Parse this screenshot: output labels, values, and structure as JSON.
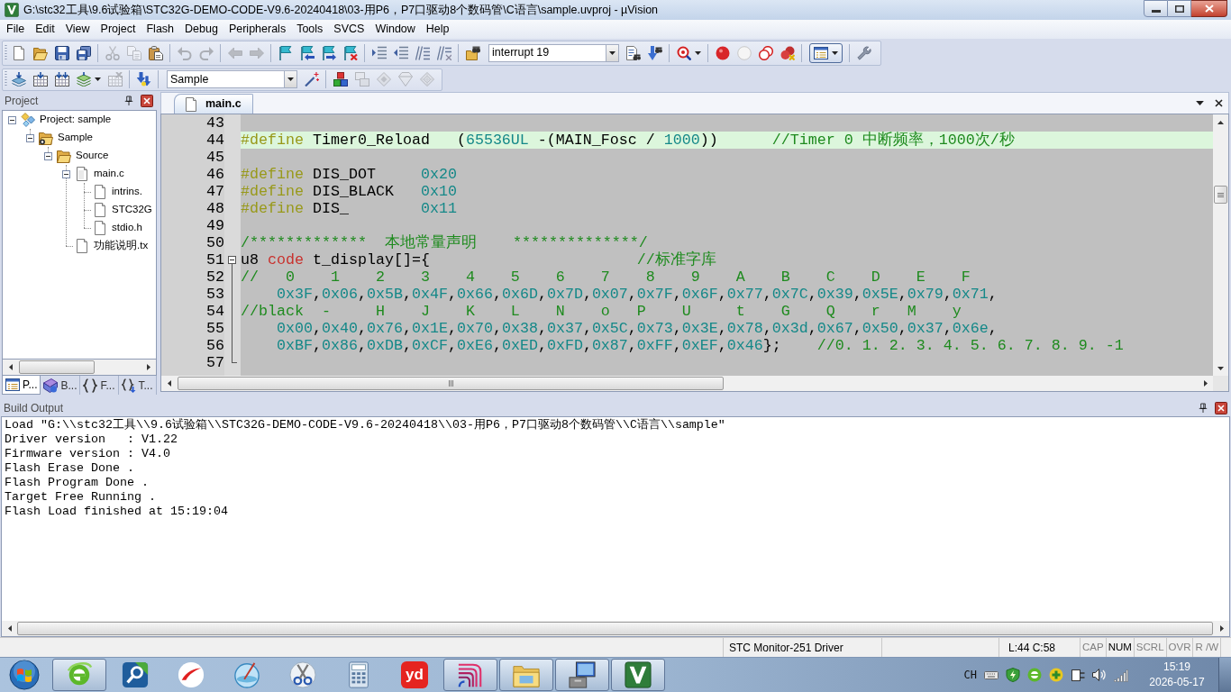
{
  "window": {
    "title": "G:\\stc32工具\\9.6试验箱\\STC32G-DEMO-CODE-V9.6-20240418\\03-用P6，P7口驱动8个数码管\\C语言\\sample.uvproj - µVision"
  },
  "menu": [
    "File",
    "Edit",
    "View",
    "Project",
    "Flash",
    "Debug",
    "Peripherals",
    "Tools",
    "SVCS",
    "Window",
    "Help"
  ],
  "toolbar_1": [
    [
      {
        "kind": "new",
        "disabled": false
      },
      {
        "kind": "open",
        "disabled": false
      },
      {
        "kind": "save",
        "disabled": false
      },
      {
        "kind": "save_all",
        "disabled": false
      }
    ],
    [
      {
        "kind": "cut",
        "disabled": true
      },
      {
        "kind": "copy",
        "disabled": true
      },
      {
        "kind": "paste",
        "disabled": false
      }
    ],
    [
      {
        "kind": "undo",
        "disabled": true
      },
      {
        "kind": "redo",
        "disabled": true
      }
    ],
    [
      {
        "kind": "back",
        "disabled": true
      },
      {
        "kind": "forward",
        "disabled": true
      }
    ],
    [
      {
        "kind": "bookmark",
        "disabled": false
      },
      {
        "kind": "bookmark_prev",
        "disabled": false
      },
      {
        "kind": "bookmark_next",
        "disabled": false
      },
      {
        "kind": "bookmark_clear",
        "disabled": false
      }
    ],
    [
      {
        "kind": "indent",
        "disabled": false
      },
      {
        "kind": "outdent",
        "disabled": false
      },
      {
        "kind": "comment",
        "disabled": false
      },
      {
        "kind": "uncomment",
        "disabled": false
      }
    ],
    [
      {
        "kind": "find_in_files",
        "disabled": false
      },
      {
        "kind": "combo",
        "value": "interrupt 19",
        "disabled": false
      },
      {
        "kind": "find",
        "disabled": false
      },
      {
        "kind": "incremental_find",
        "disabled": false
      }
    ],
    [
      {
        "kind": "debug",
        "disabled": false
      }
    ],
    [
      {
        "kind": "breakpoint",
        "disabled": false
      },
      {
        "kind": "breakpoint_enable",
        "disabled": false
      },
      {
        "kind": "breakpoint_disable_all",
        "disabled": false
      },
      {
        "kind": "breakpoint_kill_all",
        "disabled": false
      }
    ],
    [
      {
        "kind": "window_layout",
        "disabled": false
      }
    ],
    [
      {
        "kind": "configure",
        "disabled": false
      }
    ]
  ],
  "toolbar_2": [
    [
      {
        "kind": "translate",
        "disabled": false
      },
      {
        "kind": "build",
        "disabled": false
      },
      {
        "kind": "rebuild",
        "disabled": false
      },
      {
        "kind": "batch_build",
        "disabled": false
      },
      {
        "kind": "stop_build",
        "disabled": true
      }
    ],
    [
      {
        "kind": "download",
        "disabled": false
      }
    ],
    [
      {
        "kind": "combo",
        "value": "Sample",
        "disabled": false
      },
      {
        "kind": "target_options",
        "disabled": false
      }
    ],
    [
      {
        "kind": "components",
        "disabled": false
      },
      {
        "kind": "packs",
        "disabled": true
      },
      {
        "kind": "diamond",
        "disabled": true
      },
      {
        "kind": "gem",
        "disabled": true
      },
      {
        "kind": "gems",
        "disabled": true
      }
    ]
  ],
  "project_panel": {
    "title": "Project",
    "tree": [
      {
        "label": "Project: sample",
        "kind": "project",
        "expanded": true,
        "children": [
          {
            "label": "Sample",
            "kind": "group",
            "expanded": true,
            "children": [
              {
                "label": "Source",
                "kind": "folder",
                "expanded": true,
                "children": [
                  {
                    "label": "main.c",
                    "kind": "c_file",
                    "expanded": true,
                    "children": [
                      {
                        "label": "intrins.",
                        "kind": "header_file"
                      },
                      {
                        "label": "STC32G",
                        "kind": "header_file"
                      },
                      {
                        "label": "stdio.h",
                        "kind": "header_file"
                      }
                    ]
                  },
                  {
                    "label": "功能说明.tx",
                    "kind": "text_file"
                  }
                ]
              }
            ]
          }
        ]
      }
    ],
    "tabs": [
      {
        "label": "P...",
        "kind": "project",
        "selected": true
      },
      {
        "label": "B...",
        "kind": "books",
        "selected": false
      },
      {
        "label": "F...",
        "kind": "functions",
        "selected": false
      },
      {
        "label": "T...",
        "kind": "templates",
        "selected": false
      }
    ]
  },
  "editor": {
    "tabs": [
      {
        "label": "main.c",
        "selected": true
      }
    ],
    "lines": [
      {
        "number": "43",
        "current": false,
        "collapsible": false,
        "in_fold": false
      },
      {
        "number": "44",
        "current": true,
        "collapsible": false,
        "in_fold": false,
        "tokens": [
          {
            "kind": "preprocessor",
            "text": "#define"
          },
          {
            "kind": "plain",
            "text": " Timer0_Reload   ("
          },
          {
            "kind": "number",
            "text": "65536UL"
          },
          {
            "kind": "plain",
            "text": " -(MAIN_Fosc / "
          },
          {
            "kind": "number",
            "text": "1000"
          },
          {
            "kind": "plain",
            "text": "))      "
          },
          {
            "kind": "comment",
            "text": "//Timer 0 中断频率，1000次/秒"
          }
        ]
      },
      {
        "number": "45",
        "current": false,
        "collapsible": false,
        "in_fold": false
      },
      {
        "number": "46",
        "current": false,
        "collapsible": false,
        "in_fold": false,
        "tokens": [
          {
            "kind": "preprocessor",
            "text": "#define"
          },
          {
            "kind": "plain",
            "text": " DIS_DOT     "
          },
          {
            "kind": "number",
            "text": "0x20"
          }
        ]
      },
      {
        "number": "47",
        "current": false,
        "collapsible": false,
        "in_fold": false,
        "tokens": [
          {
            "kind": "preprocessor",
            "text": "#define"
          },
          {
            "kind": "plain",
            "text": " DIS_BLACK   "
          },
          {
            "kind": "number",
            "text": "0x10"
          }
        ]
      },
      {
        "number": "48",
        "current": false,
        "collapsible": false,
        "in_fold": false,
        "tokens": [
          {
            "kind": "preprocessor",
            "text": "#define"
          },
          {
            "kind": "plain",
            "text": " DIS_        "
          },
          {
            "kind": "number",
            "text": "0x11"
          }
        ]
      },
      {
        "number": "49",
        "current": false,
        "collapsible": false,
        "in_fold": false
      },
      {
        "number": "50",
        "current": false,
        "collapsible": false,
        "in_fold": false,
        "tokens": [
          {
            "kind": "comment",
            "text": "/*************  本地常量声明    **************/"
          }
        ]
      },
      {
        "number": "51",
        "current": false,
        "collapsible": true,
        "in_fold": false,
        "tokens": [
          {
            "kind": "plain",
            "text": "u8 "
          },
          {
            "kind": "keyword",
            "text": "code"
          },
          {
            "kind": "plain",
            "text": " t_display[]={                       "
          },
          {
            "kind": "comment",
            "text": "//标准字库"
          }
        ]
      },
      {
        "number": "52",
        "current": false,
        "collapsible": false,
        "in_fold": true,
        "tokens": [
          {
            "kind": "comment",
            "text": "//   0    1    2    3    4    5    6    7    8    9    A    B    C    D    E    F"
          }
        ]
      },
      {
        "number": "53",
        "current": false,
        "collapsible": false,
        "in_fold": true,
        "tokens": [
          {
            "kind": "number",
            "text": "    0x3F"
          },
          {
            "kind": "plain",
            "text": ","
          },
          {
            "kind": "number",
            "text": "0x06"
          },
          {
            "kind": "plain",
            "text": ","
          },
          {
            "kind": "number",
            "text": "0x5B"
          },
          {
            "kind": "plain",
            "text": ","
          },
          {
            "kind": "number",
            "text": "0x4F"
          },
          {
            "kind": "plain",
            "text": ","
          },
          {
            "kind": "number",
            "text": "0x66"
          },
          {
            "kind": "plain",
            "text": ","
          },
          {
            "kind": "number",
            "text": "0x6D"
          },
          {
            "kind": "plain",
            "text": ","
          },
          {
            "kind": "number",
            "text": "0x7D"
          },
          {
            "kind": "plain",
            "text": ","
          },
          {
            "kind": "number",
            "text": "0x07"
          },
          {
            "kind": "plain",
            "text": ","
          },
          {
            "kind": "number",
            "text": "0x7F"
          },
          {
            "kind": "plain",
            "text": ","
          },
          {
            "kind": "number",
            "text": "0x6F"
          },
          {
            "kind": "plain",
            "text": ","
          },
          {
            "kind": "number",
            "text": "0x77"
          },
          {
            "kind": "plain",
            "text": ","
          },
          {
            "kind": "number",
            "text": "0x7C"
          },
          {
            "kind": "plain",
            "text": ","
          },
          {
            "kind": "number",
            "text": "0x39"
          },
          {
            "kind": "plain",
            "text": ","
          },
          {
            "kind": "number",
            "text": "0x5E"
          },
          {
            "kind": "plain",
            "text": ","
          },
          {
            "kind": "number",
            "text": "0x79"
          },
          {
            "kind": "plain",
            "text": ","
          },
          {
            "kind": "number",
            "text": "0x71"
          },
          {
            "kind": "plain",
            "text": ","
          }
        ]
      },
      {
        "number": "54",
        "current": false,
        "collapsible": false,
        "in_fold": true,
        "tokens": [
          {
            "kind": "comment",
            "text": "//black  -     H    J    K    L    N    o   P    U     t    G    Q    r   M    y"
          }
        ]
      },
      {
        "number": "55",
        "current": false,
        "collapsible": false,
        "in_fold": true,
        "tokens": [
          {
            "kind": "number",
            "text": "    0x00"
          },
          {
            "kind": "plain",
            "text": ","
          },
          {
            "kind": "number",
            "text": "0x40"
          },
          {
            "kind": "plain",
            "text": ","
          },
          {
            "kind": "number",
            "text": "0x76"
          },
          {
            "kind": "plain",
            "text": ","
          },
          {
            "kind": "number",
            "text": "0x1E"
          },
          {
            "kind": "plain",
            "text": ","
          },
          {
            "kind": "number",
            "text": "0x70"
          },
          {
            "kind": "plain",
            "text": ","
          },
          {
            "kind": "number",
            "text": "0x38"
          },
          {
            "kind": "plain",
            "text": ","
          },
          {
            "kind": "number",
            "text": "0x37"
          },
          {
            "kind": "plain",
            "text": ","
          },
          {
            "kind": "number",
            "text": "0x5C"
          },
          {
            "kind": "plain",
            "text": ","
          },
          {
            "kind": "number",
            "text": "0x73"
          },
          {
            "kind": "plain",
            "text": ","
          },
          {
            "kind": "number",
            "text": "0x3E"
          },
          {
            "kind": "plain",
            "text": ","
          },
          {
            "kind": "number",
            "text": "0x78"
          },
          {
            "kind": "plain",
            "text": ","
          },
          {
            "kind": "number",
            "text": "0x3d"
          },
          {
            "kind": "plain",
            "text": ","
          },
          {
            "kind": "number",
            "text": "0x67"
          },
          {
            "kind": "plain",
            "text": ","
          },
          {
            "kind": "number",
            "text": "0x50"
          },
          {
            "kind": "plain",
            "text": ","
          },
          {
            "kind": "number",
            "text": "0x37"
          },
          {
            "kind": "plain",
            "text": ","
          },
          {
            "kind": "number",
            "text": "0x6e"
          },
          {
            "kind": "plain",
            "text": ","
          }
        ]
      },
      {
        "number": "56",
        "current": false,
        "collapsible": false,
        "in_fold": true,
        "tokens": [
          {
            "kind": "number",
            "text": "    0xBF"
          },
          {
            "kind": "plain",
            "text": ","
          },
          {
            "kind": "number",
            "text": "0x86"
          },
          {
            "kind": "plain",
            "text": ","
          },
          {
            "kind": "number",
            "text": "0xDB"
          },
          {
            "kind": "plain",
            "text": ","
          },
          {
            "kind": "number",
            "text": "0xCF"
          },
          {
            "kind": "plain",
            "text": ","
          },
          {
            "kind": "number",
            "text": "0xE6"
          },
          {
            "kind": "plain",
            "text": ","
          },
          {
            "kind": "number",
            "text": "0xED"
          },
          {
            "kind": "plain",
            "text": ","
          },
          {
            "kind": "number",
            "text": "0xFD"
          },
          {
            "kind": "plain",
            "text": ","
          },
          {
            "kind": "number",
            "text": "0x87"
          },
          {
            "kind": "plain",
            "text": ","
          },
          {
            "kind": "number",
            "text": "0xFF"
          },
          {
            "kind": "plain",
            "text": ","
          },
          {
            "kind": "number",
            "text": "0xEF"
          },
          {
            "kind": "plain",
            "text": ","
          },
          {
            "kind": "number",
            "text": "0x46"
          },
          {
            "kind": "plain",
            "text": "};    "
          },
          {
            "kind": "comment",
            "text": "//0. 1. 2. 3. 4. 5. 6. 7. 8. 9. -1"
          }
        ]
      },
      {
        "number": "57",
        "current": false,
        "collapsible": false,
        "in_fold": true
      }
    ]
  },
  "build_output": {
    "title": "Build Output",
    "lines": [
      "Load \"G:\\\\stc32工具\\\\9.6试验箱\\\\STC32G-DEMO-CODE-V9.6-20240418\\\\03-用P6，P7口驱动8个数码管\\\\C语言\\\\sample\"",
      "Driver version   : V1.22",
      "Firmware version : V4.0",
      "Flash Erase Done .",
      "Flash Program Done .",
      "Target Free Running .",
      "Flash Load finished at 15:19:04"
    ]
  },
  "status_bar": {
    "driver": "STC Monitor-251 Driver",
    "position": "L:44 C:58",
    "indicators": [
      {
        "label": "CAP",
        "on": false
      },
      {
        "label": "NUM",
        "on": true
      },
      {
        "label": "SCRL",
        "on": false
      },
      {
        "label": "OVR",
        "on": false
      },
      {
        "label": "R /W",
        "on": false
      }
    ]
  },
  "taskbar": {
    "apps": [
      {
        "kind": "browser",
        "running": true
      },
      {
        "kind": "search_tool",
        "running": false
      },
      {
        "kind": "swoosh",
        "running": false
      },
      {
        "kind": "globe",
        "running": false
      },
      {
        "kind": "scissors",
        "running": false
      },
      {
        "kind": "calculator",
        "running": false
      },
      {
        "kind": "dictionary",
        "label": "yd",
        "running": false
      },
      {
        "kind": "stripes",
        "running": true
      },
      {
        "kind": "explorer",
        "running": true
      },
      {
        "kind": "computer",
        "running": true
      },
      {
        "kind": "keil",
        "running": true
      }
    ],
    "input_language": "CH",
    "tray_icons": [
      {
        "kind": "keyboard"
      },
      {
        "kind": "shield"
      },
      {
        "kind": "browser"
      },
      {
        "kind": "plus"
      },
      {
        "kind": "plug"
      },
      {
        "kind": "speaker"
      },
      {
        "kind": "signal"
      }
    ],
    "clock": {
      "time": "15:19",
      "date": "2026-05-17"
    }
  }
}
